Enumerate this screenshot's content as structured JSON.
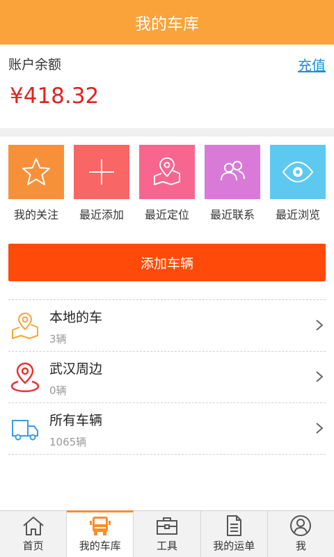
{
  "header": {
    "title": "我的车库"
  },
  "account": {
    "label": "账户余额",
    "recharge_label": "充值",
    "amount": "¥418.32"
  },
  "quick_actions": [
    {
      "label": "我的关注",
      "icon": "star-icon",
      "color": "#f6913a"
    },
    {
      "label": "最近添加",
      "icon": "plus-icon",
      "color": "#f86666"
    },
    {
      "label": "最近定位",
      "icon": "map-pin-icon",
      "color": "#f6668e"
    },
    {
      "label": "最近联系",
      "icon": "contacts-icon",
      "color": "#d97ad9"
    },
    {
      "label": "最近浏览",
      "icon": "eye-icon",
      "color": "#5ec9f0"
    }
  ],
  "add_button": {
    "label": "添加车辆"
  },
  "vehicle_groups": [
    {
      "title": "本地的车",
      "count": "3辆",
      "icon": "local-map-pin-icon",
      "color": "#f7a43a"
    },
    {
      "title": "武汉周边",
      "count": "0辆",
      "icon": "location-pin-icon",
      "color": "#e83232"
    },
    {
      "title": "所有车辆",
      "count": "1065辆",
      "icon": "truck-icon",
      "color": "#3a9ae6"
    }
  ],
  "tabs": [
    {
      "label": "首页",
      "icon": "home-icon",
      "active": false
    },
    {
      "label": "我的车库",
      "icon": "garage-truck-icon",
      "active": true
    },
    {
      "label": "工具",
      "icon": "toolbox-icon",
      "active": false
    },
    {
      "label": "我的运单",
      "icon": "document-icon",
      "active": false
    },
    {
      "label": "我",
      "icon": "user-icon",
      "active": false
    }
  ],
  "colors": {
    "header": "#f9a33a",
    "accent": "#ff4a0a",
    "balance": "#e62020",
    "link": "#1a8ee0",
    "tab_active": "#f98e2b"
  }
}
